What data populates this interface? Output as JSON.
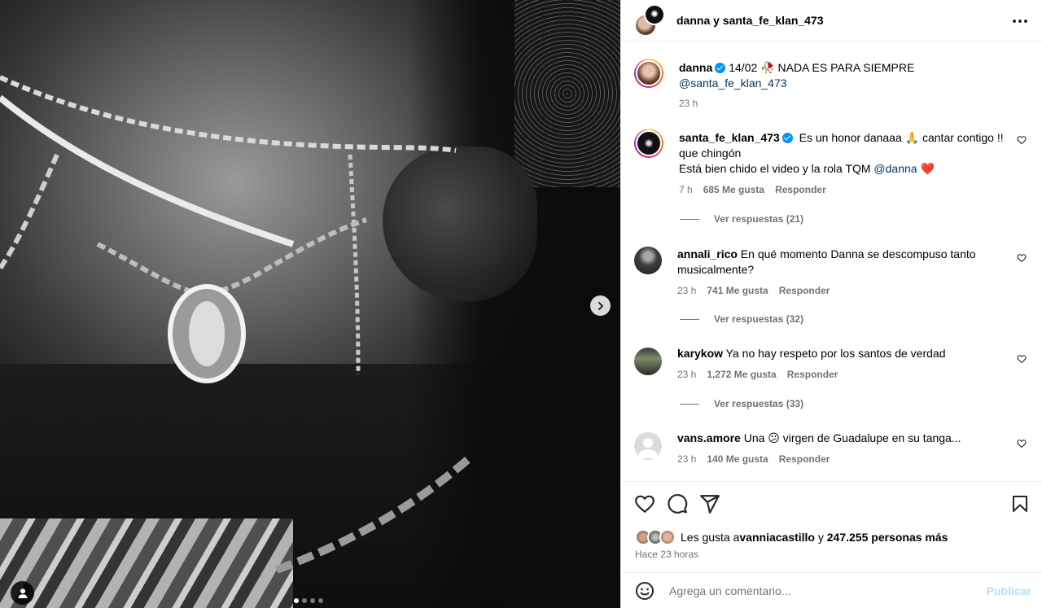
{
  "post": {
    "carousel": {
      "total": 4,
      "active": 0
    },
    "header": {
      "title": "danna y santa_fe_klan_473"
    }
  },
  "caption": {
    "username": "danna",
    "text_prefix": "14/02 ",
    "emoji": "🥀",
    "text": " NADA ES PARA SIEMPRE",
    "mention": "@santa_fe_klan_473",
    "time": "23 h"
  },
  "comments": [
    {
      "username": "santa_fe_klan_473",
      "verified": true,
      "text_1": " Es un honor danaaa ",
      "emoji_1": "🙏",
      "text_2": " cantar contigo !! que chingón",
      "text_3": "Está bien chido el video y la rola TQM ",
      "mention": "@danna",
      "emoji_2": "❤️",
      "time": "7 h",
      "likes": "685 Me gusta",
      "reply": "Responder",
      "replies": "Ver respuestas (21)"
    },
    {
      "username": "annali_rico",
      "text": " En qué momento Danna se descompuso tanto musicalmente?",
      "time": "23 h",
      "likes": "741 Me gusta",
      "reply": "Responder",
      "replies": "Ver respuestas (32)"
    },
    {
      "username": "karykow",
      "text": " Ya no hay respeto por los santos de verdad",
      "time": "23 h",
      "likes": "1,272 Me gusta",
      "reply": "Responder",
      "replies": "Ver respuestas (33)"
    },
    {
      "username": "vans.amore",
      "text_1": " Una ",
      "emoji": "😕",
      "text_2": " virgen de Guadalupe en su tanga...",
      "time": "23 h",
      "likes": "140 Me gusta",
      "reply": "Responder"
    }
  ],
  "likes": {
    "prefix": "Les gusta a ",
    "user": "vanniacastillo",
    "middle": " y ",
    "count": "247.255 personas más"
  },
  "posted_ago": "Hace 23 horas",
  "add_comment": {
    "placeholder": "Agrega un comentario...",
    "publish": "Publicar"
  },
  "colors": {
    "verified": "#0095f6",
    "mention": "#00376b",
    "secondary": "#737373",
    "publish_disabled": "#b2dffc",
    "heart": "#ed4956"
  },
  "icons": [
    "more-icon",
    "heart-icon",
    "comment-icon",
    "share-icon",
    "bookmark-icon",
    "emoji-icon",
    "chevron-right-icon",
    "user-tag-icon"
  ]
}
